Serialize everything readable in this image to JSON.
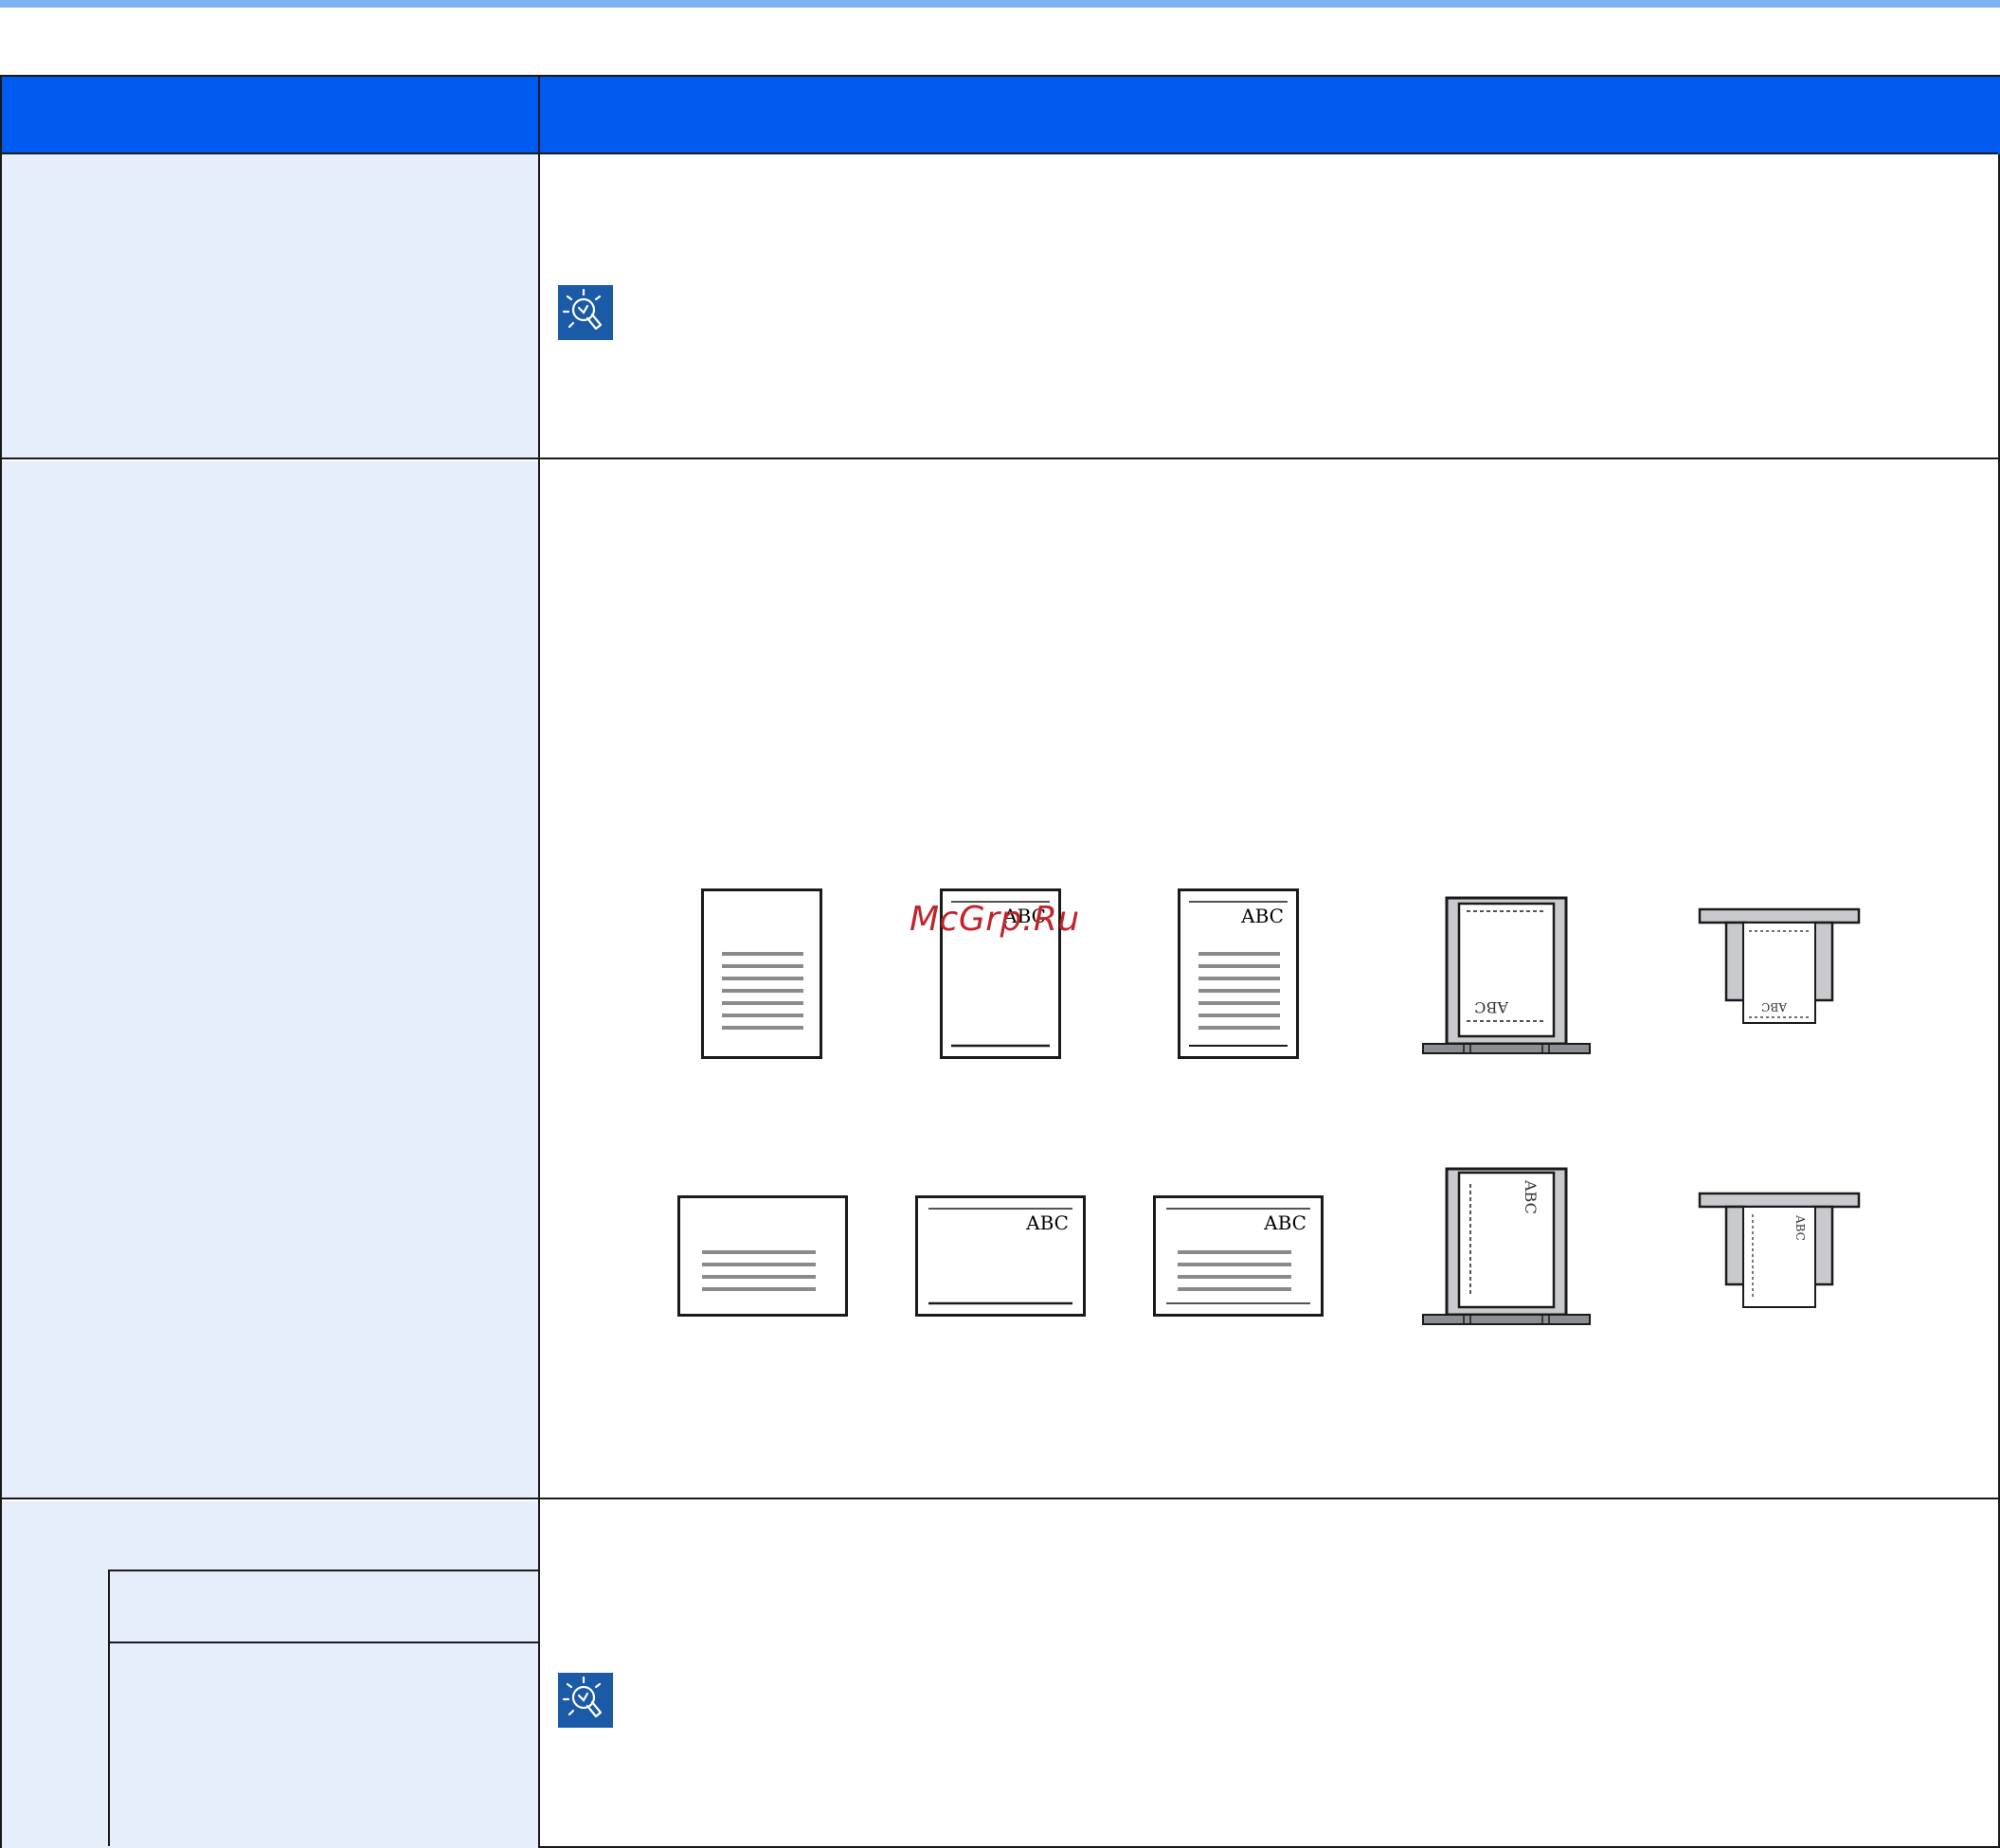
{
  "watermark": "McGrp.Ru",
  "colors": {
    "header_blue": "#005aef",
    "top_rule": "#7fb2f0",
    "left_cell": "#e6eefb",
    "icon_blue": "#1b5aa6",
    "border": "#1a1a1a",
    "tray_gray": "#c8cacd",
    "tray_dark": "#8b8e93"
  },
  "icons": [
    "hint-lightbulb-icon",
    "hint-lightbulb-icon"
  ],
  "illustrations": {
    "sample_text": "ABC",
    "rows": [
      [
        "blank-lined-page",
        "abc-header-footer-page",
        "abc-header-lined-page",
        "platen-placed-original",
        "tray-loaded-original"
      ],
      [
        "landscape-lined-page",
        "landscape-abc-header-footer-page",
        "landscape-abc-lined-page",
        "platen-rotated-original",
        "tray-rotated-original"
      ]
    ]
  }
}
